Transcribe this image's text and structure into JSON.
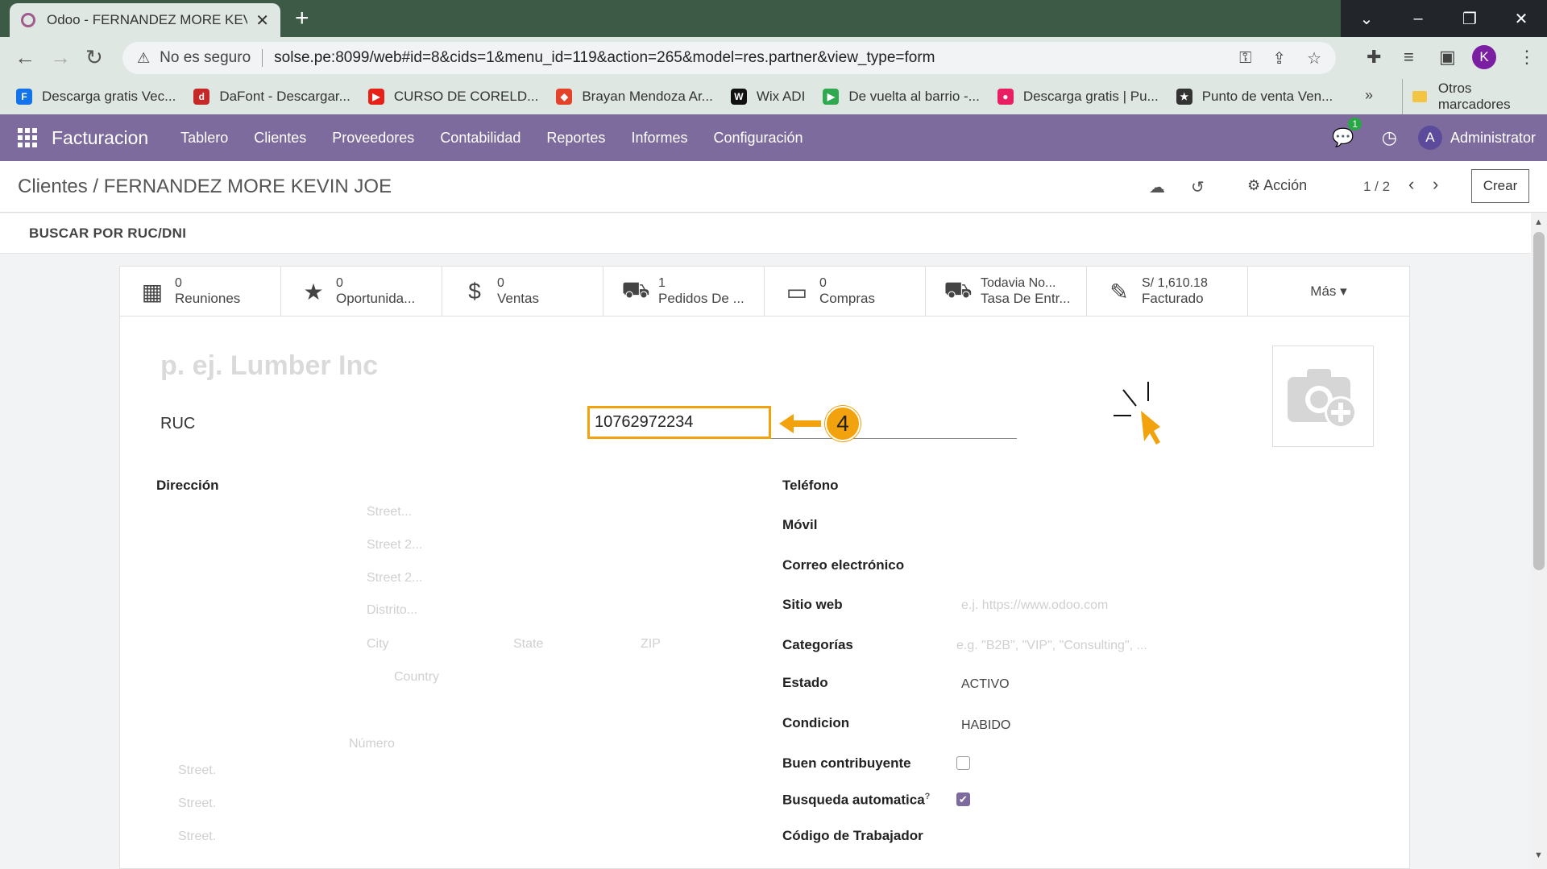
{
  "browser": {
    "tab_title": "Odoo - FERNANDEZ MORE KEVIN JOE",
    "new_tab": "+",
    "security_label": "No es seguro",
    "url": "solse.pe:8099/web#id=8&cids=1&menu_id=119&action=265&model=res.partner&view_type=form",
    "profile_initial": "K",
    "bookmarks": [
      {
        "label": "Descarga gratis Vec...",
        "icon": "freepik-icon",
        "color": "#1273eb",
        "glyph": "F"
      },
      {
        "label": "DaFont - Descargar...",
        "icon": "dafont-icon",
        "color": "#c62828",
        "glyph": "d"
      },
      {
        "label": "CURSO DE CORELD...",
        "icon": "youtube-icon",
        "color": "#e62117",
        "glyph": "▶"
      },
      {
        "label": "Brayan Mendoza Ar...",
        "icon": "gitlab-icon",
        "color": "#e24329",
        "glyph": "◆"
      },
      {
        "label": "Wix ADI",
        "icon": "wix-icon",
        "color": "#111111",
        "glyph": "W"
      },
      {
        "label": "De vuelta al barrio -...",
        "icon": "play-icon",
        "color": "#2fa84f",
        "glyph": "▶"
      },
      {
        "label": "Descarga gratis | Pu...",
        "icon": "drop-icon",
        "color": "#e91e63",
        "glyph": "●"
      },
      {
        "label": "Punto de venta Ven...",
        "icon": "star-badge-icon",
        "color": "#333333",
        "glyph": "★"
      }
    ],
    "bookmarks_more": "»",
    "other_bookmarks": "Otros marcadores"
  },
  "odoo": {
    "app_name": "Facturacion",
    "menu": [
      "Tablero",
      "Clientes",
      "Proveedores",
      "Contabilidad",
      "Reportes",
      "Informes",
      "Configuración"
    ],
    "chat_count": "1",
    "user_initial": "A",
    "user_name": "Administrator",
    "accent": "#7c6b9c"
  },
  "control": {
    "breadcrumb_parent": "Clientes",
    "breadcrumb_sep": "/",
    "breadcrumb_current": "FERNANDEZ MORE KEVIN JOE",
    "action_label": "Acción",
    "pager": "1 / 2",
    "create_label": "Crear"
  },
  "search_ruc_label": "BUSCAR POR RUC/DNI",
  "smart_buttons": [
    {
      "value": "0",
      "label": "Reuniones",
      "icon": "calendar-icon",
      "glyph": "📅"
    },
    {
      "value": "0",
      "label": "Oportunida...",
      "icon": "star-icon",
      "glyph": "★"
    },
    {
      "value": "0",
      "label": "Ventas",
      "icon": "dollar-icon",
      "glyph": "$"
    },
    {
      "value": "1",
      "label": "Pedidos De ...",
      "icon": "bag-icon",
      "glyph": "👜"
    },
    {
      "value": "0",
      "label": "Compras",
      "icon": "credit-card-icon",
      "glyph": "▭"
    },
    {
      "value": "Todavia No...",
      "label": "Tasa De Entr...",
      "icon": "truck-icon",
      "glyph": "🚚"
    },
    {
      "value": "S/ 1,610.18",
      "label": "Facturado",
      "icon": "edit-icon",
      "glyph": "✎"
    }
  ],
  "more_label": "Más",
  "form": {
    "name_placeholder": "p. ej. Lumber Inc",
    "ruc_label": "RUC",
    "ruc_value": "10762972234",
    "step_number": "4",
    "address_label": "Dirección",
    "address_placeholders": {
      "street": "Street...",
      "street2a": "Street 2...",
      "street2b": "Street 2...",
      "district": "Distrito...",
      "city": "City",
      "state": "State",
      "zip": "ZIP",
      "country": "Country",
      "number": "Número",
      "s1": "Street.",
      "s2": "Street.",
      "s3": "Street."
    },
    "phone_label": "Teléfono",
    "mobile_label": "Móvil",
    "email_label": "Correo electrónico",
    "website_label": "Sitio web",
    "website_placeholder": "e.j. https://www.odoo.com",
    "categories_label": "Categorías",
    "categories_placeholder": "e.g. \"B2B\", \"VIP\", \"Consulting\", ...",
    "estado_label": "Estado",
    "estado_value": "ACTIVO",
    "condicion_label": "Condicion",
    "condicion_value": "HABIDO",
    "buen_contribuyente_label": "Buen contribuyente",
    "buen_contribuyente_checked": false,
    "busqueda_label": "Busqueda automatica",
    "busqueda_help": "?",
    "busqueda_checked": true,
    "codigo_label": "Código de Trabajador"
  },
  "annotation_color": "#f2a20c"
}
